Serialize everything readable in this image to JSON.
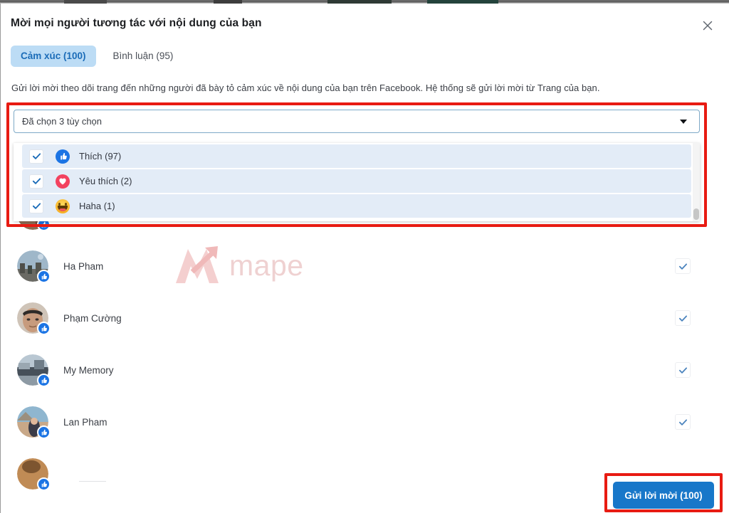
{
  "dialog": {
    "title": "Mời mọi người tương tác với nội dung của bạn",
    "close_icon": "close-icon",
    "description": "Gửi lời mời theo dõi trang đến những người đã bày tỏ cảm xúc về nội dung của bạn trên Facebook. Hệ thống sẽ gửi lời mời từ Trang của bạn."
  },
  "tabs": [
    {
      "label": "Cảm xúc (100)",
      "active": true
    },
    {
      "label": "Bình luận (95)",
      "active": false
    }
  ],
  "filter": {
    "selected_text": "Đã chọn 3 tùy chọn",
    "caret_icon": "chevron-down-icon",
    "options": [
      {
        "label": "Thích (97)",
        "icon": "thumbs-up-icon",
        "checked": true
      },
      {
        "label": "Yêu thích (2)",
        "icon": "heart-icon",
        "checked": true
      },
      {
        "label": "Haha (1)",
        "icon": "haha-emoji-icon",
        "checked": true
      }
    ]
  },
  "people": [
    {
      "name": "Ha Pham",
      "reaction_icon": "thumbs-up-badge-icon",
      "checked": true
    },
    {
      "name": "Phạm Cường",
      "reaction_icon": "thumbs-up-badge-icon",
      "checked": true
    },
    {
      "name": "My Memory",
      "reaction_icon": "thumbs-up-badge-icon",
      "checked": true
    },
    {
      "name": "Lan Pham",
      "reaction_icon": "thumbs-up-badge-icon",
      "checked": true
    }
  ],
  "watermark": {
    "text": "mape",
    "logo_icon": "mape-arrow-logo-icon"
  },
  "footer": {
    "submit_label": "Gửi lời mời (100)"
  },
  "colors": {
    "accent_blue": "#1877c9",
    "tab_active_bg": "#bcdcf5",
    "tab_active_text": "#1b6cb8",
    "annotation_red": "#e81b12",
    "option_row_bg": "#e3ecf7",
    "like_blue": "#1b74e4",
    "love_red": "#f3425f",
    "haha_yellow": "#f7b125"
  }
}
